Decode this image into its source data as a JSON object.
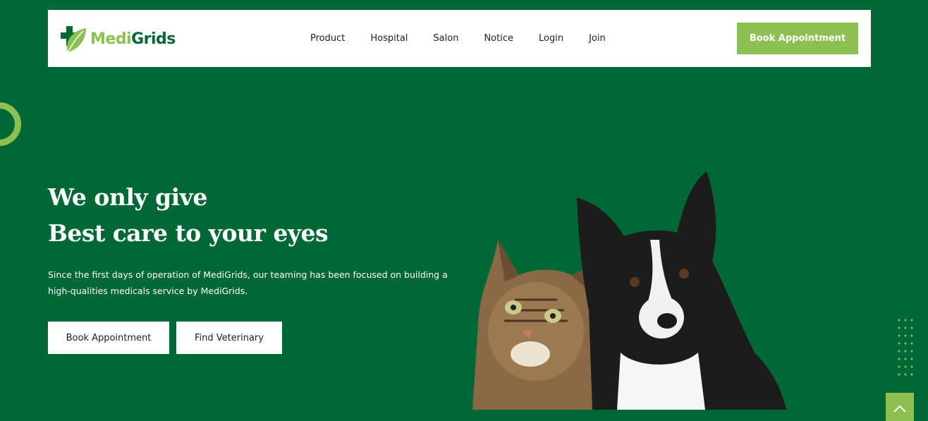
{
  "brand": {
    "name_part1": "Medi",
    "name_part2": "Grids"
  },
  "nav": {
    "items": [
      "Product",
      "Hospital",
      "Salon",
      "Notice",
      "Login",
      "Join"
    ],
    "cta_label": "Book Appointment"
  },
  "hero": {
    "title_line1": "We only give",
    "title_line2": "Best care to your eyes",
    "description": "Since the first days of operation of MediGrids, our teaming has been focused on building a high-qualities medicals service by MediGrids.",
    "primary_button": "Book Appointment",
    "secondary_button": "Find Veterinary"
  },
  "colors": {
    "background": "#006837",
    "accent": "#8cc152",
    "white": "#ffffff"
  },
  "icons": [
    "medical-cross-leaf-logo-icon",
    "chevron-up-icon"
  ]
}
